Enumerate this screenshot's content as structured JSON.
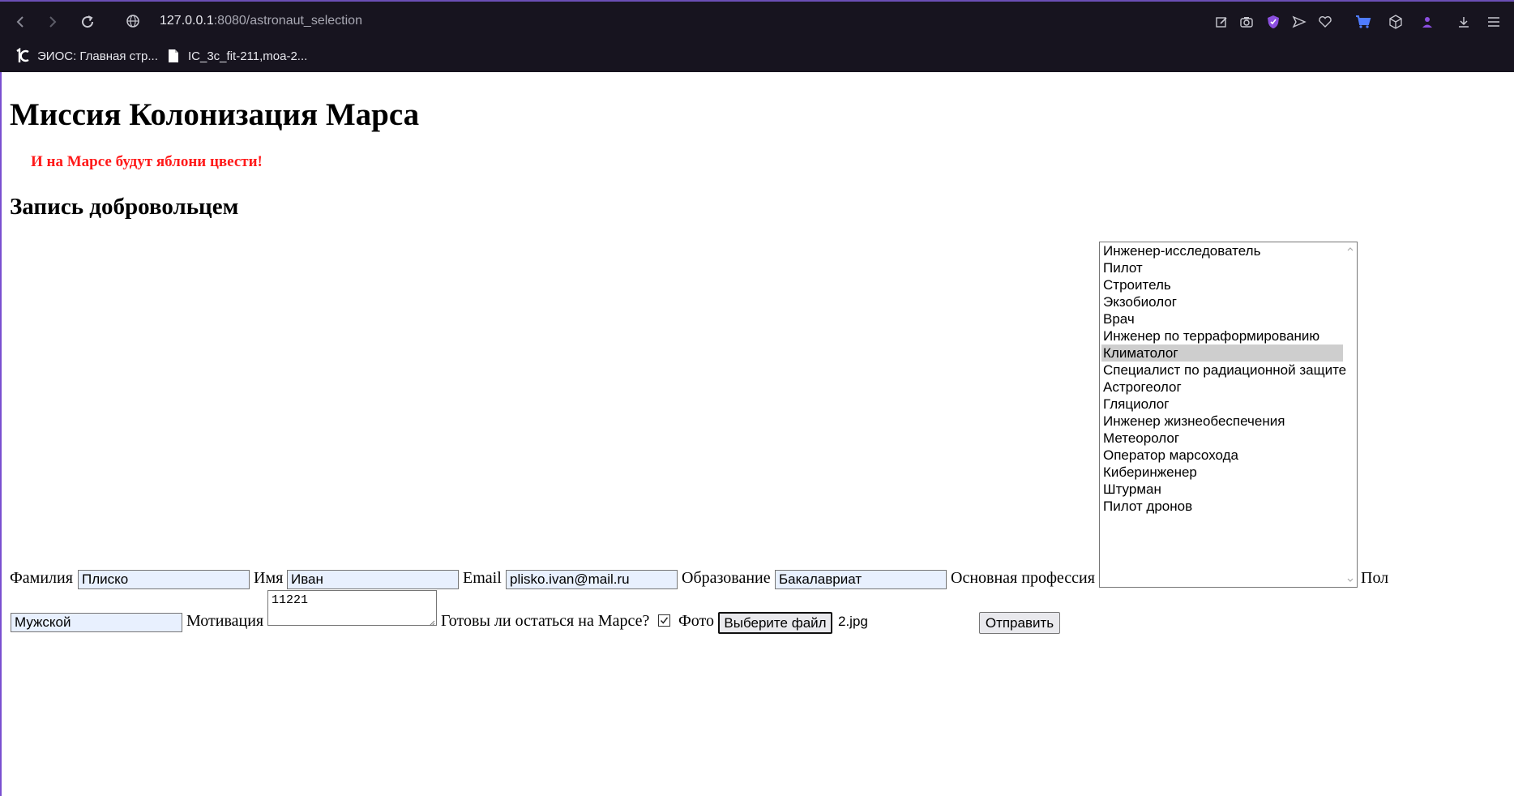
{
  "browser": {
    "url_host": "127.0.0.1",
    "url_path": ":8080/astronaut_selection",
    "bookmarks": [
      {
        "label": "ЭИОС: Главная стр..."
      },
      {
        "label": "IC_3c_fit-211,moa-2..."
      }
    ],
    "accent_color": "#7a4fd0"
  },
  "page": {
    "title": "Миссия Колонизация Марса",
    "slogan": "И на Марсе будут яблони цвести!",
    "slogan_color": "#ff1a1a",
    "subtitle": "Запись добровольцем"
  },
  "form": {
    "surname_label": "Фамилия",
    "surname_value": "Плиско",
    "name_label": "Имя",
    "name_value": "Иван",
    "email_label": "Email",
    "email_value": "plisko.ivan@mail.ru",
    "education_label": "Образование",
    "education_value": "Бакалавриат",
    "profession_label": "Основная профессия",
    "professions": [
      "Инженер-исследователь",
      "Пилот",
      "Строитель",
      "Экзобиолог",
      "Врач",
      "Инженер по терраформированию",
      "Климатолог",
      "Специалист по радиационной защите",
      "Астрогеолог",
      "Гляциолог",
      "Инженер жизнеобеспечения",
      "Метеоролог",
      "Оператор марсохода",
      "Киберинженер",
      "Штурман",
      "Пилот дронов"
    ],
    "selected_profession": "Климатолог",
    "gender_label": "Пол",
    "gender_value": "Мужской",
    "motivation_label": "Мотивация",
    "motivation_value": "11221",
    "stay_label": "Готовы ли остаться на Марсе?",
    "stay_checked": true,
    "photo_label": "Фото",
    "file_button_label": "Выберите файл",
    "file_name": "2.jpg",
    "submit_label": "Отправить"
  }
}
